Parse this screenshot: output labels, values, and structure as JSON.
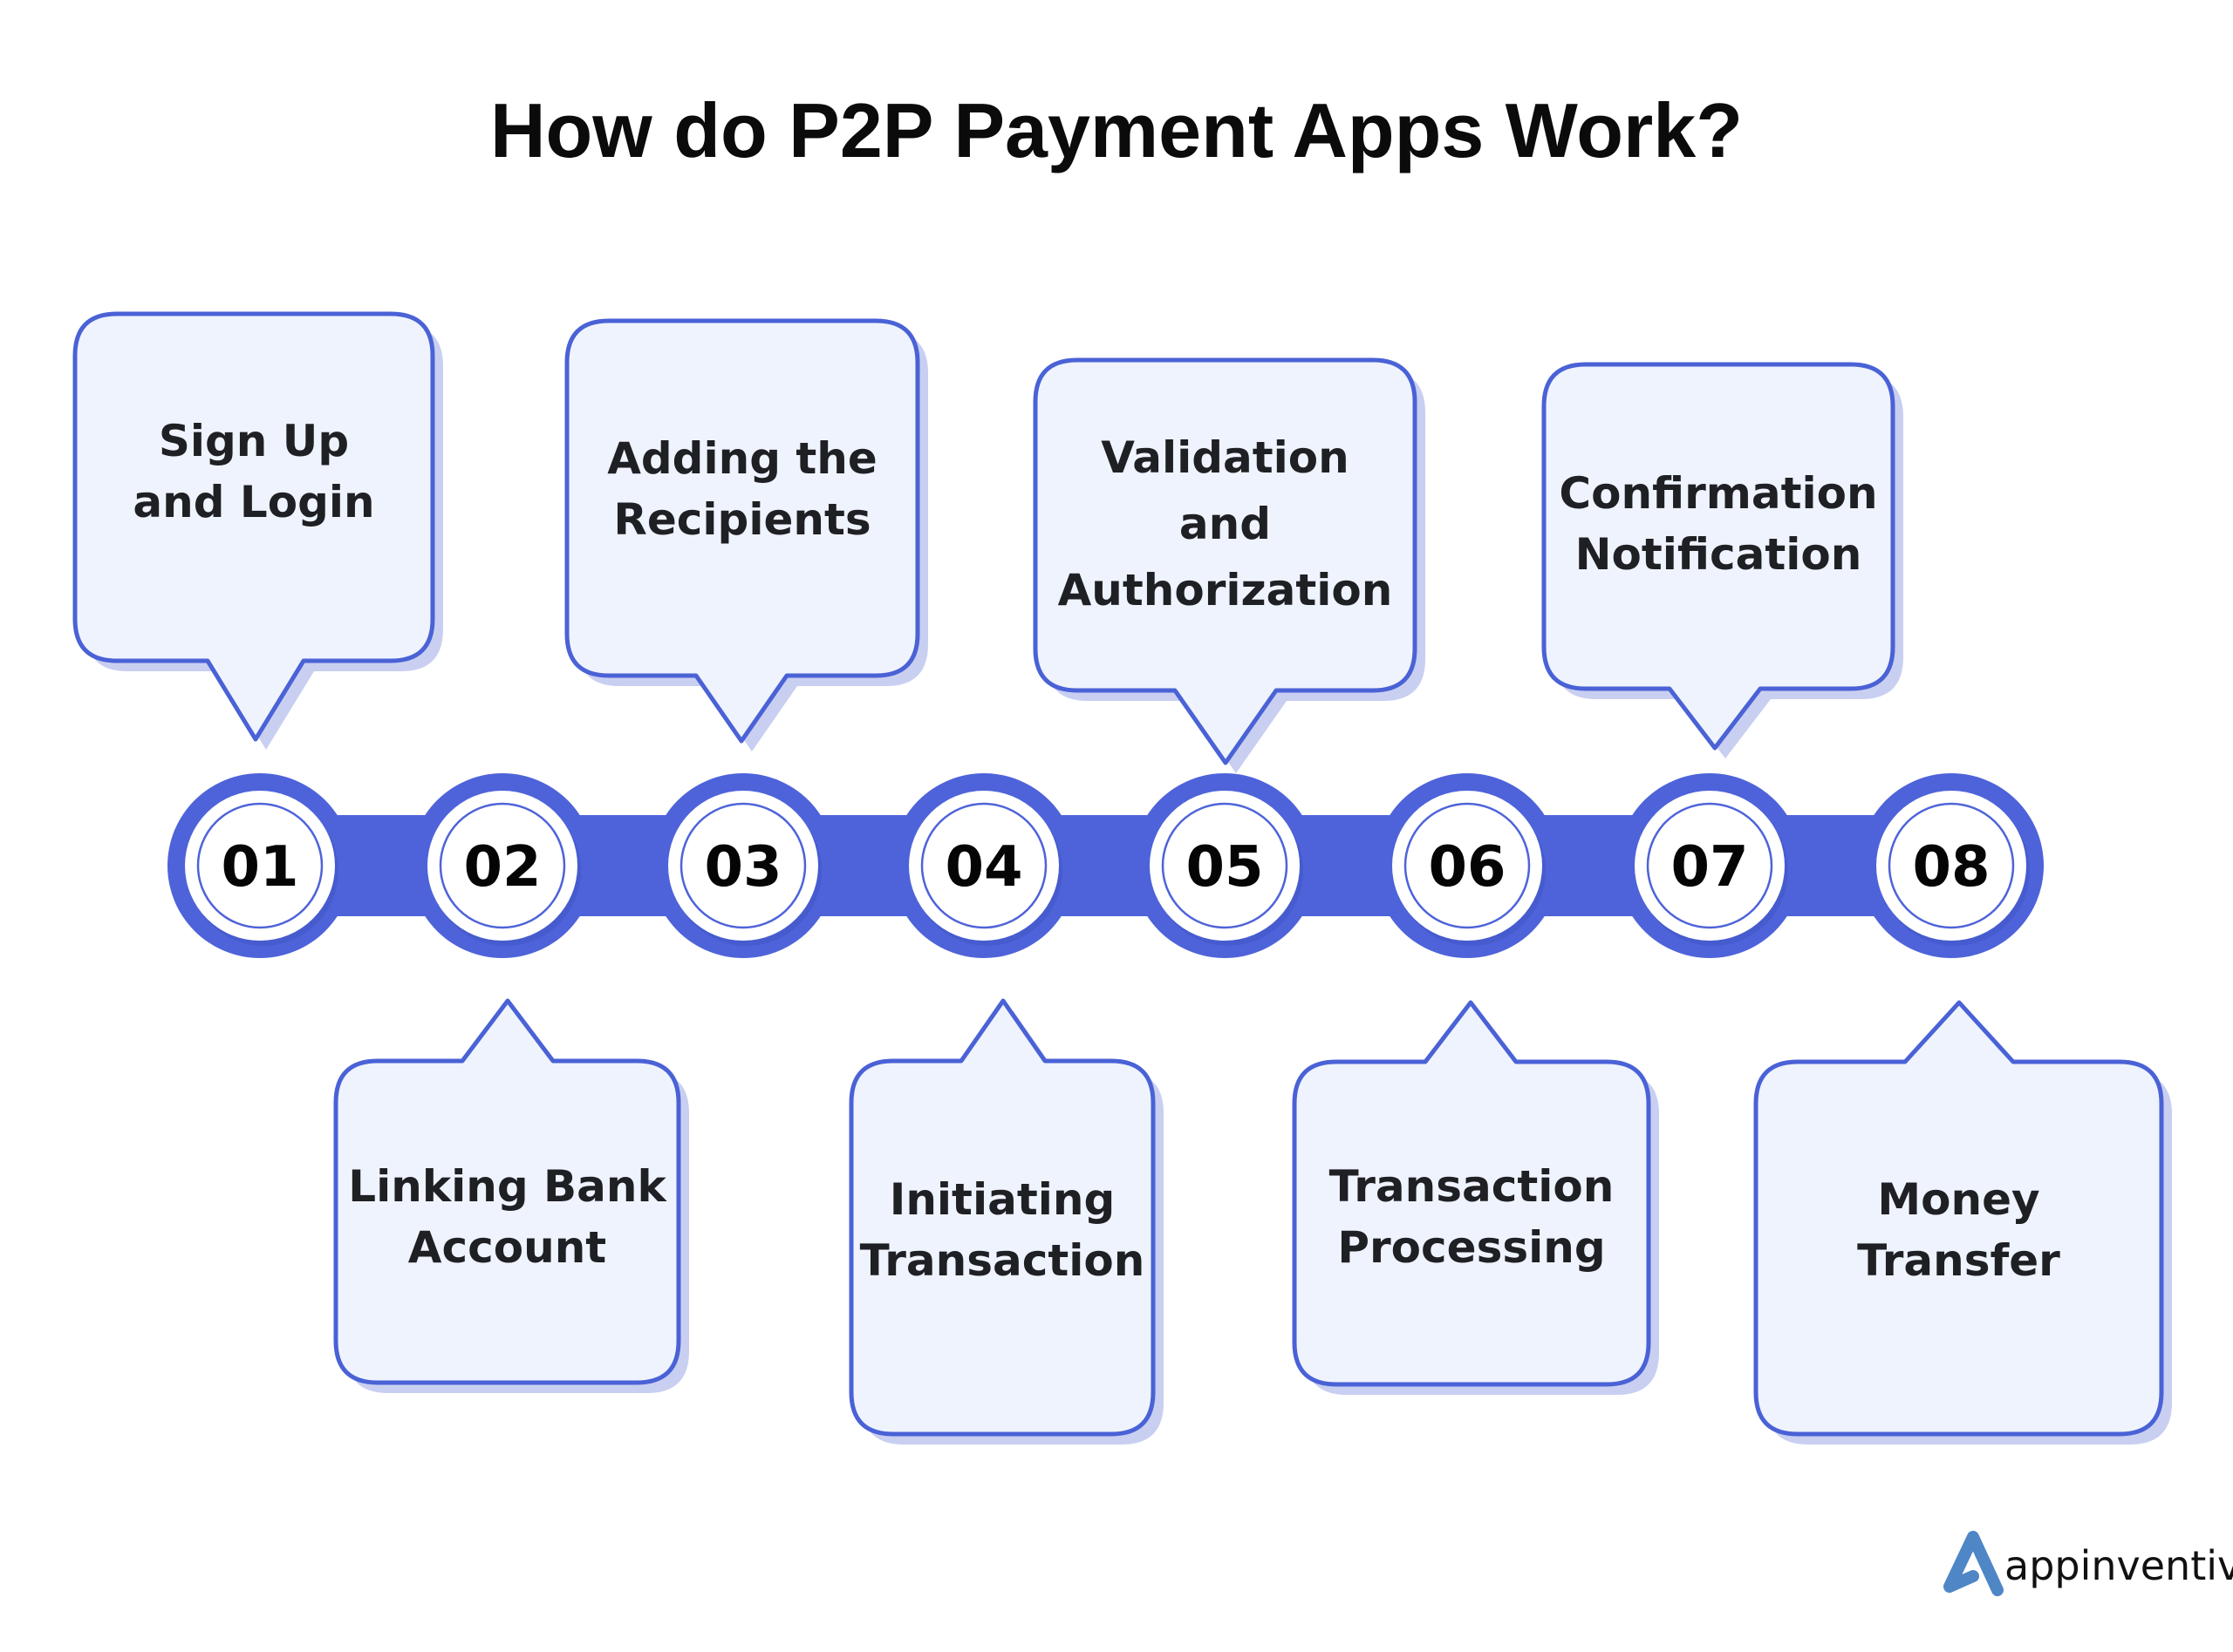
{
  "title": "How do P2P Payment Apps Work?",
  "colors": {
    "accent": "#4e63d9",
    "callout_fill": "#eff3fd",
    "callout_border": "#4a62d6",
    "callout_shadow": "#c9cff1",
    "text": "#1f2024",
    "logo_mark": "#4f86c6"
  },
  "steps": [
    {
      "number": "01",
      "lines": [
        "Sign Up",
        "and Login"
      ],
      "position": "top"
    },
    {
      "number": "02",
      "lines": [
        "Linking Bank",
        "Account"
      ],
      "position": "bottom"
    },
    {
      "number": "03",
      "lines": [
        "Adding the",
        "Recipients"
      ],
      "position": "top"
    },
    {
      "number": "04",
      "lines": [
        "Initiating",
        "Transaction"
      ],
      "position": "bottom"
    },
    {
      "number": "05",
      "lines": [
        "Validation",
        "and",
        "Authorization"
      ],
      "position": "top"
    },
    {
      "number": "06",
      "lines": [
        "Transaction",
        "Processing"
      ],
      "position": "bottom"
    },
    {
      "number": "07",
      "lines": [
        "Confirmation",
        "Notification"
      ],
      "position": "top"
    },
    {
      "number": "08",
      "lines": [
        "Money",
        "Transfer"
      ],
      "position": "bottom"
    }
  ],
  "logo": {
    "icon": "appinventiv-a-icon",
    "text": "appinventiv"
  }
}
